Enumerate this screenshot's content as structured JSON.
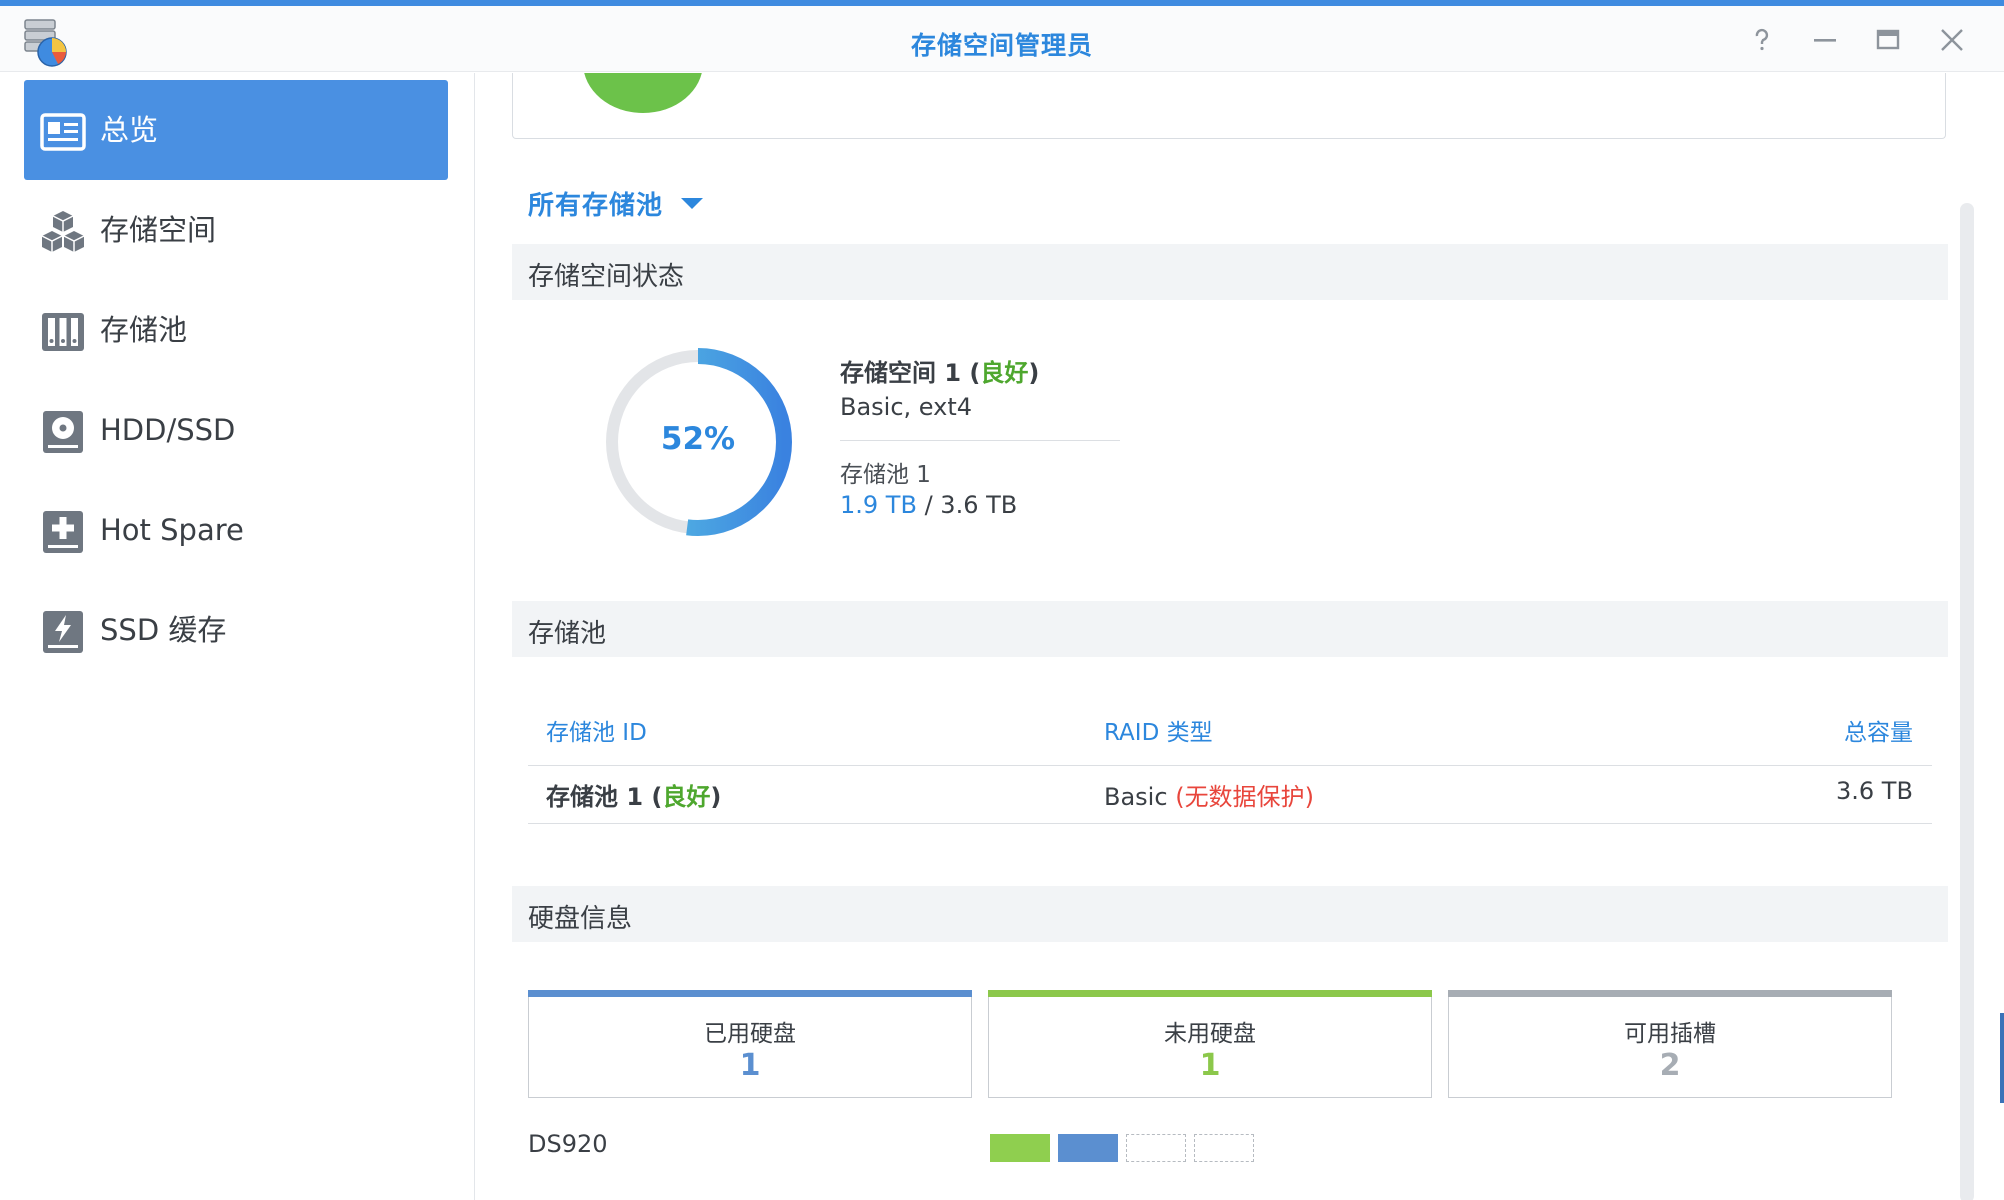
{
  "window": {
    "title": "存储空间管理员",
    "controls": [
      "help-icon",
      "minimize-icon",
      "maximize-icon",
      "close-icon"
    ]
  },
  "sidebar": {
    "items": [
      {
        "label": "总览",
        "icon": "overview-icon",
        "active": true
      },
      {
        "label": "存储空间",
        "icon": "volume-cubes-icon"
      },
      {
        "label": "存储池",
        "icon": "storage-pool-icon"
      },
      {
        "label": "HDD/SSD",
        "icon": "hdd-icon"
      },
      {
        "label": "Hot Spare",
        "icon": "hot-spare-icon"
      },
      {
        "label": "SSD 缓存",
        "icon": "ssd-cache-icon"
      }
    ]
  },
  "main": {
    "pool_filter": "所有存储池",
    "volume_status": {
      "header": "存储空间状态",
      "usage_percent": "52%",
      "usage_fraction": 0.52,
      "volume_name": "存储空间 1",
      "volume_health": "良好",
      "volume_desc": "Basic, ext4",
      "pool_name": "存储池 1",
      "used": "1.9 TB",
      "separator": "/",
      "total": "3.6 TB"
    },
    "storage_pool": {
      "header": "存储池",
      "columns": [
        "存储池 ID",
        "RAID 类型",
        "总容量"
      ],
      "rows": [
        {
          "name": "存储池 1",
          "health": "良好",
          "raid": "Basic",
          "raid_note": "无数据保护",
          "capacity": "3.6 TB"
        }
      ]
    },
    "disk_info": {
      "header": "硬盘信息",
      "boxes": [
        {
          "label": "已用硬盘",
          "value": "1",
          "color": "#5b8fd0"
        },
        {
          "label": "未用硬盘",
          "value": "1",
          "color": "#8cc84b"
        },
        {
          "label": "可用插槽",
          "value": "2",
          "color": "#a7adb4"
        }
      ],
      "model": "DS920"
    }
  },
  "colors": {
    "accent": "#4a90e2",
    "good": "#4ea72e",
    "warn": "#e8463c"
  }
}
